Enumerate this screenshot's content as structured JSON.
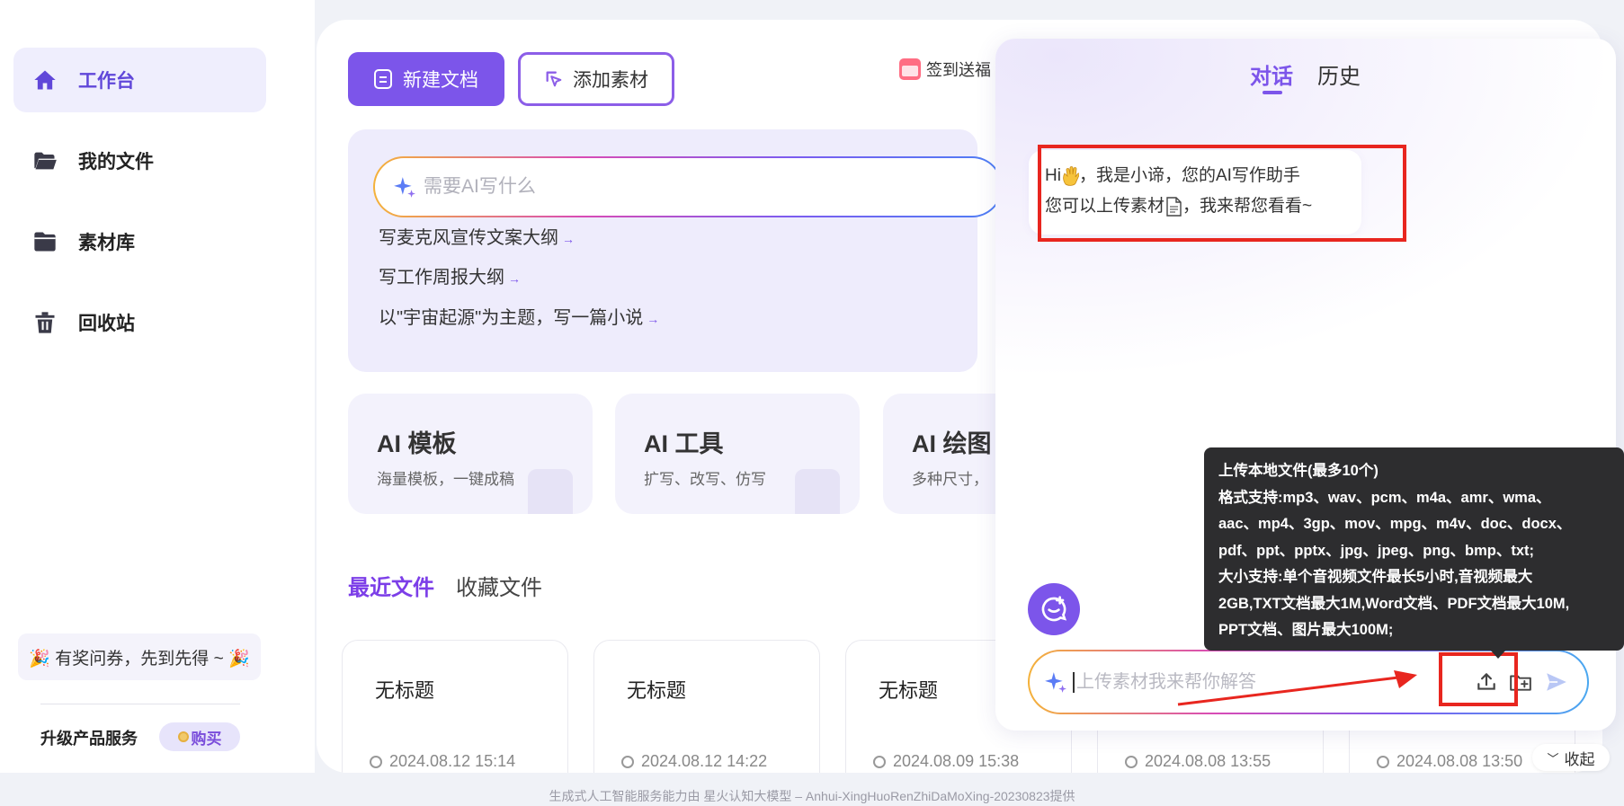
{
  "sidebar": {
    "items": [
      {
        "label": "工作台",
        "icon": "home-icon"
      },
      {
        "label": "我的文件",
        "icon": "folder-open-icon"
      },
      {
        "label": "素材库",
        "icon": "folder-icon"
      },
      {
        "label": "回收站",
        "icon": "trash-icon"
      }
    ],
    "survey": "🎉 有奖问券，先到先得 ~ 🎉",
    "upgrade_label": "升级产品服务",
    "buy_label": "购买"
  },
  "toolbar": {
    "new_doc": "新建文档",
    "add_material": "添加素材",
    "checkin": "签到送福"
  },
  "ai": {
    "placeholder": "需要AI写什么",
    "suggestions": [
      "写麦克风宣传文案大纲",
      "写工作周报大纲",
      "以\"宇宙起源\"为主题，写一篇小说"
    ]
  },
  "cards": [
    {
      "title": "AI 模板",
      "sub": "海量模板，一键成稿"
    },
    {
      "title": "AI 工具",
      "sub": "扩写、改写、仿写"
    },
    {
      "title": "AI 绘图",
      "sub": "多种尺寸，"
    }
  ],
  "files": {
    "tab_recent": "最近文件",
    "tab_fav": "收藏文件",
    "items": [
      {
        "title": "无标题",
        "time": "2024.08.12 15:14"
      },
      {
        "title": "无标题",
        "time": "2024.08.12 14:22"
      },
      {
        "title": "无标题",
        "time": "2024.08.09 15:38"
      },
      {
        "title": "",
        "time": "2024.08.08 13:55"
      },
      {
        "title": "",
        "time": "2024.08.08 13:50"
      }
    ]
  },
  "chat": {
    "tab_chat": "对话",
    "tab_history": "历史",
    "greeting_line1_a": "Hi",
    "greeting_line1_b": "，我是小谛，您的AI写作助手",
    "greeting_line2_a": "您可以上传素材",
    "greeting_line2_b": "，我来帮您看看~",
    "input_placeholder": "上传素材我来帮你解答"
  },
  "tooltip": {
    "lines": [
      "上传本地文件(最多10个)",
      "格式支持:mp3、wav、pcm、m4a、amr、wma、",
      "aac、mp4、3gp、mov、mpg、m4v、doc、docx、",
      "pdf、ppt、pptx、jpg、jpeg、png、bmp、txt;",
      "大小支持:单个音视频文件最长5小时,音视频最大",
      "2GB,TXT文档最大1M,Word文档、PDF文档最大10M,",
      "PPT文档、图片最大100M;"
    ]
  },
  "collapse_label": "收起",
  "footer": "生成式人工智能服务能力由 星火认知大模型 – Anhui-XingHuoRenZhiDaMoXing-20230823提供",
  "colors": {
    "accent": "#7c55ea",
    "highlight": "#e8261f"
  }
}
